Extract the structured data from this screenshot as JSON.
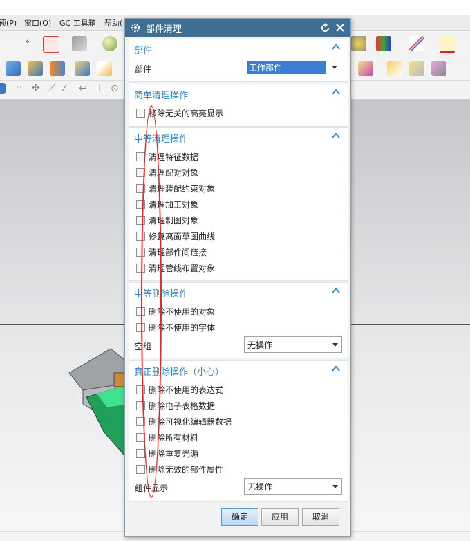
{
  "menubar": {
    "items": [
      "预(P)",
      "窗口(O)",
      "GC 工具箱",
      "帮助("
    ]
  },
  "dialog": {
    "title": "部件清理",
    "sections": {
      "part": {
        "title": "部件",
        "field_label": "部件",
        "field_value": "工作部件"
      },
      "simple": {
        "title": "简单清理操作",
        "items": [
          "移除无关的高亮显示"
        ]
      },
      "medium_clean": {
        "title": "中等清理操作",
        "items": [
          "清理特征数据",
          "清理配对对象",
          "清理装配约束对象",
          "清理加工对象",
          "清理制图对象",
          "修复离面草图曲线",
          "清理部件间链接",
          "清理管线布置对象"
        ]
      },
      "medium_delete": {
        "title": "中等删除操作",
        "items": [
          "删除不使用的对象",
          "删除不使用的字体"
        ],
        "field_label": "空组",
        "field_value": "无操作"
      },
      "real_delete": {
        "title": "真正删除操作（小心）",
        "items": [
          "删除不使用的表达式",
          "删除电子表格数据",
          "删除可视化编辑器数据",
          "删除所有材料",
          "删除重复光源",
          "删除无效的部件属性"
        ],
        "field_label": "组件显示",
        "field_value": "无操作"
      }
    },
    "buttons": {
      "ok": "确定",
      "apply": "应用",
      "cancel": "取消"
    }
  },
  "colors": {
    "titlebar": "#3f6f95",
    "section_title": "#2f86c6",
    "annotation": "#e8262a",
    "ok_button": "#cfe3f5"
  }
}
